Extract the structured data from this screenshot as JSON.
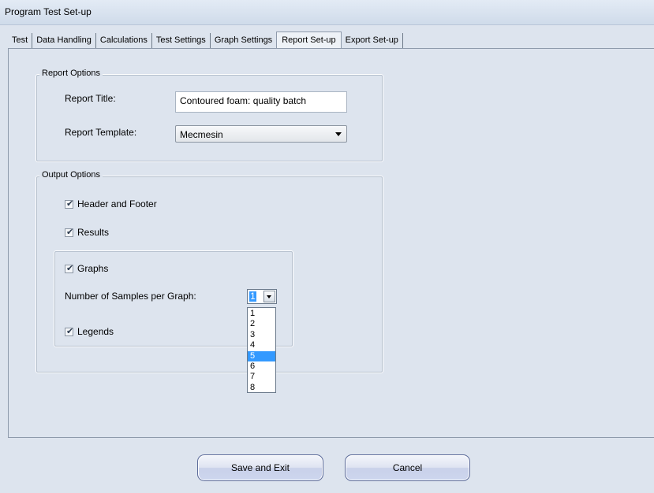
{
  "window": {
    "title": "Program Test Set-up"
  },
  "tabs": [
    {
      "label": "Test"
    },
    {
      "label": "Data Handling"
    },
    {
      "label": "Calculations"
    },
    {
      "label": "Test Settings"
    },
    {
      "label": "Graph Settings"
    },
    {
      "label": "Report Set-up",
      "active": true
    },
    {
      "label": "Export Set-up"
    }
  ],
  "report_options": {
    "legend": "Report Options",
    "title_label": "Report Title:",
    "title_value": "Contoured foam: quality batch",
    "template_label": "Report Template:",
    "template_value": "Mecmesin"
  },
  "output_options": {
    "legend": "Output Options",
    "header_footer": {
      "label": "Header and Footer",
      "checked": true
    },
    "results": {
      "label": "Results",
      "checked": true
    },
    "graphs": {
      "label": "Graphs",
      "checked": true
    },
    "samples_label": "Number of Samples per Graph:",
    "samples_value": "1",
    "samples_options": [
      "1",
      "2",
      "3",
      "4",
      "5",
      "6",
      "7",
      "8"
    ],
    "samples_highlighted": "5",
    "legends": {
      "label": "Legends",
      "checked": true
    }
  },
  "buttons": {
    "save": "Save and Exit",
    "cancel": "Cancel"
  },
  "colors": {
    "background": "#dde4ee",
    "highlight": "#3399ff"
  }
}
